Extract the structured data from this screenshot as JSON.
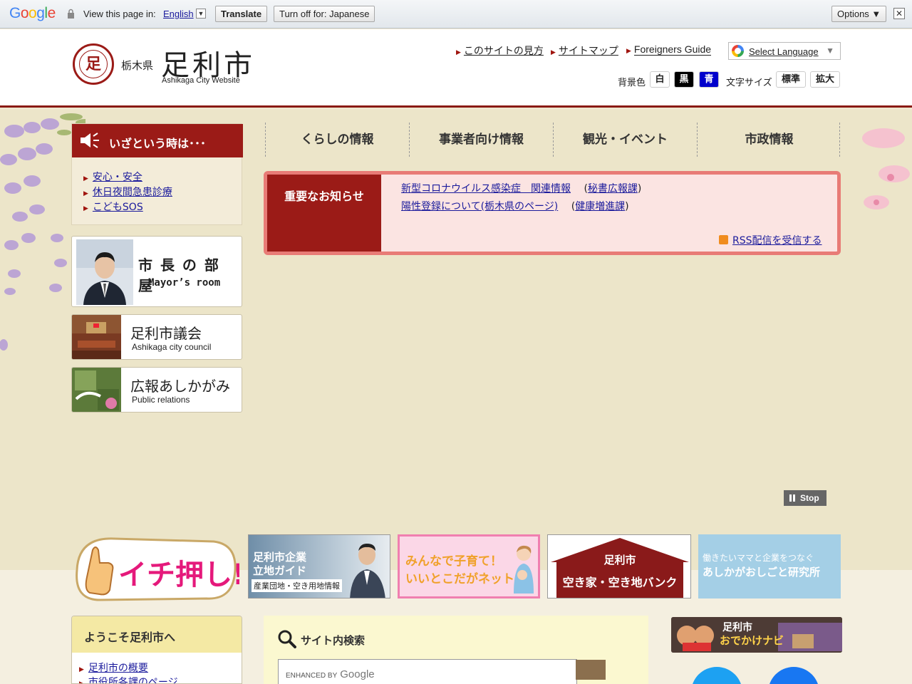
{
  "translate_bar": {
    "logo": "Google",
    "view_text": "View this page in:",
    "language": "English",
    "translate_btn": "Translate",
    "turnoff_btn": "Turn off for: Japanese",
    "options_btn": "Options ▼",
    "close": "✕"
  },
  "header": {
    "prefecture": "栃木県",
    "city_name": "足利市",
    "city_en": "Ashikaga City Website",
    "seal_char": "足",
    "links": [
      "このサイトの見方",
      "サイトマップ",
      "Foreigners Guide"
    ],
    "select_language": "Select Language",
    "bg_label": "背景色",
    "bg_options": [
      "白",
      "黒",
      "青"
    ],
    "font_label": "文字サイズ",
    "font_options": [
      "標準",
      "拡大"
    ]
  },
  "emergency": {
    "title": "いざという時は･･･",
    "items": [
      "安心・安全",
      "休日夜間急患診療",
      "こどもSOS"
    ]
  },
  "side_banners": {
    "mayor": {
      "jp": "市 長 の 部 屋",
      "en": "Mayor’s room"
    },
    "council": {
      "jp": "足利市議会",
      "en": "Ashikaga city council"
    },
    "pr": {
      "jp": "広報あしかがみ",
      "en": "Public relations"
    }
  },
  "nav": [
    "くらしの情報",
    "事業者向け情報",
    "観光・イベント",
    "市政情報"
  ],
  "notice": {
    "title": "重要なお知らせ",
    "items": [
      {
        "link": "新型コロナウイルス感染症　関連情報",
        "dept": "秘書広報課"
      },
      {
        "link": "陽性登録について(栃木県のページ)",
        "dept": "健康増進課"
      }
    ],
    "rss": "RSS配信を受信する"
  },
  "slideshow": {
    "stop": "Stop"
  },
  "promo": {
    "ichi": "イチ押し!",
    "b1_l1": "足利市企業",
    "b1_l2": "立地ガイド",
    "b1_l3": "産業団地・空き用地情報",
    "b2_l1": "みんなで子育て！",
    "b2_l2": "いいとこだがネット",
    "b3_l1": "足利市",
    "b3_l2": "空き家・空き地バンク",
    "b4_l1": "働きたいママと企業をつなぐ",
    "b4_l2": "あしかがおしごと研究所"
  },
  "welcome": {
    "title": "ようこそ足利市へ",
    "items": [
      "足利市の概要",
      "市役所各課のページ"
    ]
  },
  "search": {
    "title": "サイト内検索",
    "enhanced": "ENHANCED BY",
    "google": "Google"
  },
  "odekake": {
    "l1": "足利市",
    "l2": "おでかけナビ"
  },
  "colors": {
    "brand_red": "#9b1b17",
    "notice_border": "#e87b76"
  }
}
